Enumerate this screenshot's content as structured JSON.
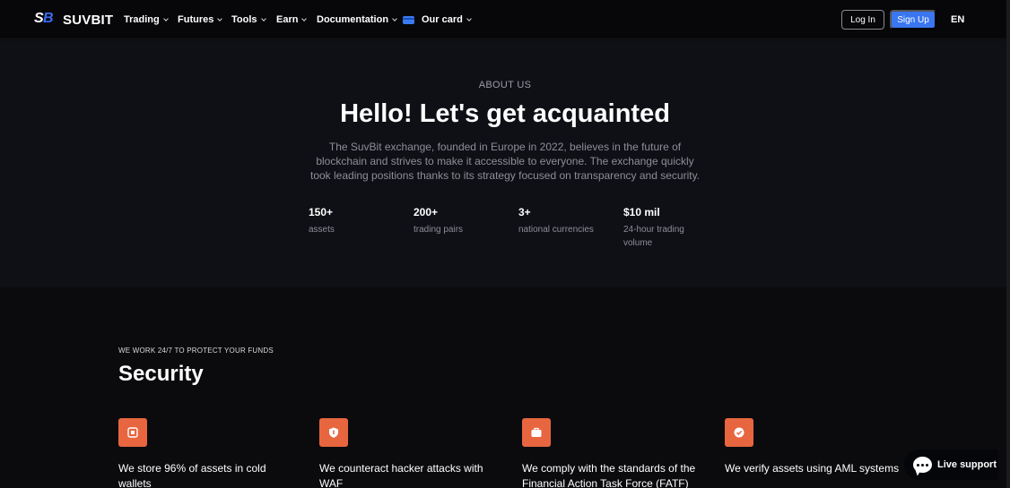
{
  "brand": {
    "name": "SUVBIT",
    "mark_s": "S",
    "mark_b": "B",
    "mark_color": "#3b6cf2"
  },
  "nav": {
    "items": [
      {
        "label": "Trading"
      },
      {
        "label": "Futures"
      },
      {
        "label": "Tools"
      },
      {
        "label": "Earn"
      },
      {
        "label": "Documentation"
      },
      {
        "label": "Our card",
        "icon": "card-icon"
      }
    ],
    "login_label": "Log In",
    "signup_label": "Sign Up",
    "language": "EN"
  },
  "hero": {
    "eyebrow": "ABOUT US",
    "title": "Hello! Let's get acquainted",
    "description": "The SuvBit exchange, founded in Europe in 2022, believes in the future of blockchain and strives to make it accessible to everyone. The exchange quickly took leading positions thanks to its strategy focused on transparency and security.",
    "stats": [
      {
        "value": "150+",
        "label": "assets"
      },
      {
        "value": "200+",
        "label": "trading pairs"
      },
      {
        "value": "3+",
        "label": "national currencies"
      },
      {
        "value": "$10 mil",
        "label": "24-hour trading volume"
      }
    ]
  },
  "security": {
    "eyebrow": "WE WORK 24/7 TO PROTECT YOUR FUNDS",
    "title": "Security",
    "features": [
      {
        "icon": "cold-wallet-icon",
        "text": "We store 96% of assets in cold wallets"
      },
      {
        "icon": "shield-icon",
        "text": "We counteract hacker attacks with WAF"
      },
      {
        "icon": "briefcase-icon",
        "text": "We comply with the standards of the Financial Action Task Force (FATF)"
      },
      {
        "icon": "verified-badge-icon",
        "text": "We verify assets using AML systems"
      }
    ]
  },
  "support": {
    "label": "Live support"
  },
  "colors": {
    "accent": "#e8663f",
    "primary": "#3a76f0",
    "background": "#0b0b0e"
  }
}
